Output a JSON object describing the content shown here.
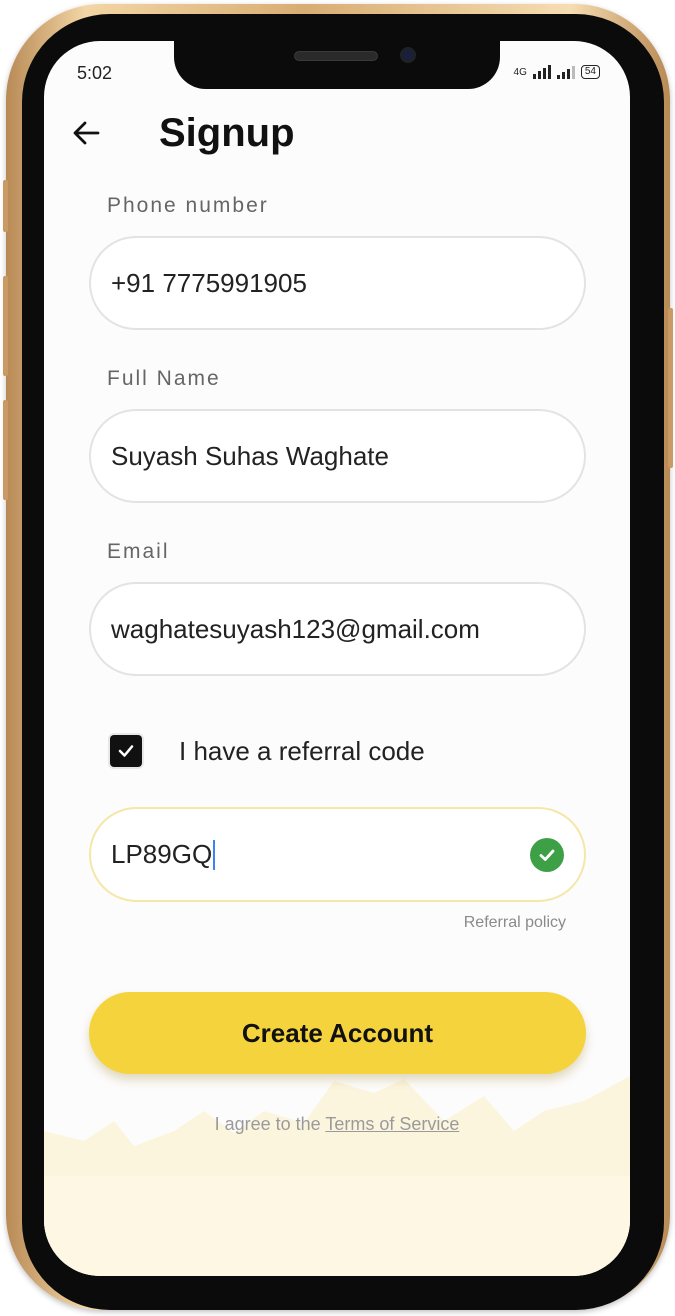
{
  "status_bar": {
    "time": "5:02",
    "network": "4G",
    "battery": "54"
  },
  "header": {
    "back_icon": "arrow-left-icon",
    "title": "Signup"
  },
  "form": {
    "phone": {
      "label": "Phone number",
      "value": "+91 7775991905"
    },
    "name": {
      "label": "Full Name",
      "value": "Suyash Suhas Waghate"
    },
    "email": {
      "label": "Email",
      "value": "waghatesuyash123@gmail.com"
    },
    "referral_checkbox": {
      "label": "I have a referral code",
      "checked": true
    },
    "referral_code": {
      "value": "LP89GQ",
      "valid_icon": "check-circle-icon"
    },
    "referral_policy": "Referral policy"
  },
  "actions": {
    "create_account": "Create Account"
  },
  "footer": {
    "terms_prefix": "I agree to the ",
    "terms_link": "Terms of Service"
  },
  "colors": {
    "accent": "#f4d33d",
    "success": "#3da047",
    "referral_border": "#f4e7a8",
    "device_frame": "#d8ad73"
  }
}
